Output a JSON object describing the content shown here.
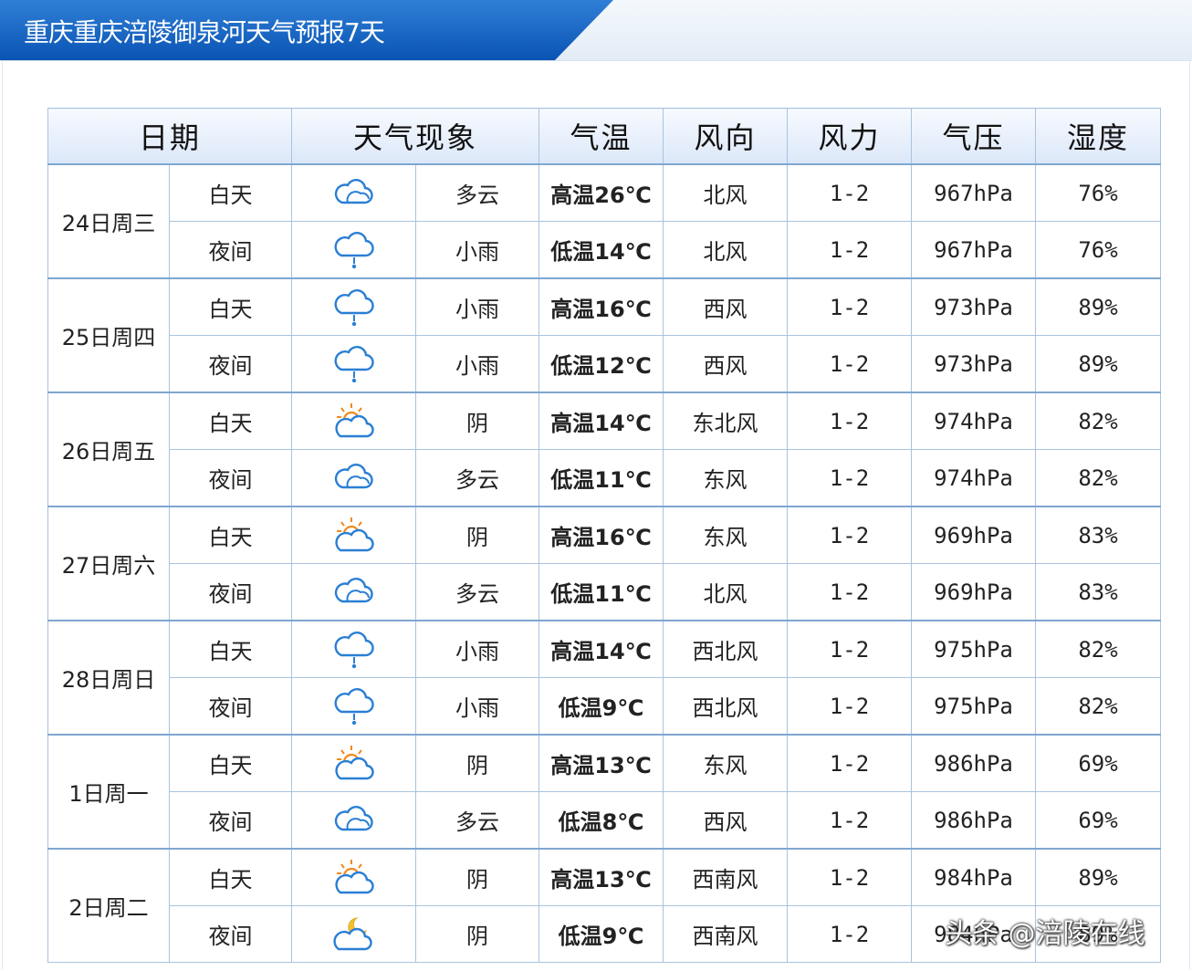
{
  "header": {
    "title": "重庆重庆涪陵御泉河天气预报7天"
  },
  "table": {
    "headers": [
      "日期",
      "天气现象",
      "气温",
      "风向",
      "风力",
      "气压",
      "湿度"
    ],
    "days": [
      {
        "date": "24日周三",
        "periods": [
          {
            "period": "白天",
            "icon": "cloudy-icon",
            "weather": "多云",
            "temp": "高温26℃",
            "temp_type": "high",
            "wind_dir": "北风",
            "wind_force": "1-2",
            "pressure": "967hPa",
            "humidity": "76%"
          },
          {
            "period": "夜间",
            "icon": "light-rain-icon",
            "weather": "小雨",
            "temp": "低温14℃",
            "temp_type": "low",
            "wind_dir": "北风",
            "wind_force": "1-2",
            "pressure": "967hPa",
            "humidity": "76%"
          }
        ]
      },
      {
        "date": "25日周四",
        "periods": [
          {
            "period": "白天",
            "icon": "light-rain-icon",
            "weather": "小雨",
            "temp": "高温16℃",
            "temp_type": "high",
            "wind_dir": "西风",
            "wind_force": "1-2",
            "pressure": "973hPa",
            "humidity": "89%"
          },
          {
            "period": "夜间",
            "icon": "light-rain-icon",
            "weather": "小雨",
            "temp": "低温12℃",
            "temp_type": "low",
            "wind_dir": "西风",
            "wind_force": "1-2",
            "pressure": "973hPa",
            "humidity": "89%"
          }
        ]
      },
      {
        "date": "26日周五",
        "periods": [
          {
            "period": "白天",
            "icon": "sun-cloud-icon",
            "weather": "阴",
            "temp": "高温14℃",
            "temp_type": "high",
            "wind_dir": "东北风",
            "wind_force": "1-2",
            "pressure": "974hPa",
            "humidity": "82%"
          },
          {
            "period": "夜间",
            "icon": "cloudy-icon",
            "weather": "多云",
            "temp": "低温11℃",
            "temp_type": "low",
            "wind_dir": "东风",
            "wind_force": "1-2",
            "pressure": "974hPa",
            "humidity": "82%"
          }
        ]
      },
      {
        "date": "27日周六",
        "periods": [
          {
            "period": "白天",
            "icon": "sun-cloud-icon",
            "weather": "阴",
            "temp": "高温16℃",
            "temp_type": "high",
            "wind_dir": "东风",
            "wind_force": "1-2",
            "pressure": "969hPa",
            "humidity": "83%"
          },
          {
            "period": "夜间",
            "icon": "cloudy-icon",
            "weather": "多云",
            "temp": "低温11℃",
            "temp_type": "low",
            "wind_dir": "北风",
            "wind_force": "1-2",
            "pressure": "969hPa",
            "humidity": "83%"
          }
        ]
      },
      {
        "date": "28日周日",
        "periods": [
          {
            "period": "白天",
            "icon": "light-rain-icon",
            "weather": "小雨",
            "temp": "高温14℃",
            "temp_type": "high",
            "wind_dir": "西北风",
            "wind_force": "1-2",
            "pressure": "975hPa",
            "humidity": "82%"
          },
          {
            "period": "夜间",
            "icon": "light-rain-icon",
            "weather": "小雨",
            "temp": "低温9℃",
            "temp_type": "low",
            "wind_dir": "西北风",
            "wind_force": "1-2",
            "pressure": "975hPa",
            "humidity": "82%"
          }
        ]
      },
      {
        "date": "1日周一",
        "periods": [
          {
            "period": "白天",
            "icon": "sun-cloud-icon",
            "weather": "阴",
            "temp": "高温13℃",
            "temp_type": "high",
            "wind_dir": "东风",
            "wind_force": "1-2",
            "pressure": "986hPa",
            "humidity": "69%"
          },
          {
            "period": "夜间",
            "icon": "cloudy-icon",
            "weather": "多云",
            "temp": "低温8℃",
            "temp_type": "low",
            "wind_dir": "西风",
            "wind_force": "1-2",
            "pressure": "986hPa",
            "humidity": "69%"
          }
        ]
      },
      {
        "date": "2日周二",
        "periods": [
          {
            "period": "白天",
            "icon": "sun-cloud-icon",
            "weather": "阴",
            "temp": "高温13℃",
            "temp_type": "high",
            "wind_dir": "西南风",
            "wind_force": "1-2",
            "pressure": "984hPa",
            "humidity": "89%"
          },
          {
            "period": "夜间",
            "icon": "moon-cloud-icon",
            "weather": "阴",
            "temp": "低温9℃",
            "temp_type": "low",
            "wind_dir": "西南风",
            "wind_force": "1-2",
            "pressure": "984hPa",
            "humidity": "89%"
          }
        ]
      }
    ]
  },
  "watermark": {
    "text": "头条 @涪陵在线"
  },
  "colors": {
    "banner": "#0a54b4",
    "border": "#a9c3de",
    "temp_high": "#e8251c",
    "temp_low": "#213c9c"
  }
}
